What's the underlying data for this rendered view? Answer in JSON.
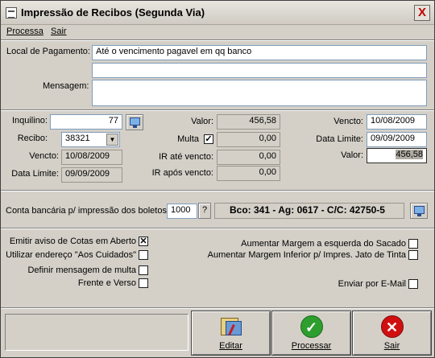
{
  "window": {
    "title": "Impressão de Recibos (Segunda Via)",
    "close": "X"
  },
  "menu": {
    "processa": "Processa",
    "sair": "Sair"
  },
  "pagamento": {
    "label": "Local de Pagamento:",
    "value": "Até o vencimento pagavel em qq banco",
    "value2": ""
  },
  "mensagem": {
    "label": "Mensagem:",
    "value": ""
  },
  "inquilino": {
    "label": "Inquilino:",
    "value": "77"
  },
  "recibo": {
    "label": "Recibo:",
    "value": "38321"
  },
  "vencto": {
    "label": "Vencto:",
    "value": "10/08/2009"
  },
  "data_limite": {
    "label": "Data Limite:",
    "value": "09/09/2009"
  },
  "valor": {
    "label": "Valor:",
    "value": "456,58"
  },
  "multa": {
    "label": "Multa",
    "checked": "✓",
    "value": "0,00"
  },
  "ir_ate": {
    "label": "IR até vencto:",
    "value": "0,00"
  },
  "ir_apos": {
    "label": "IR após vencto:",
    "value": "0,00"
  },
  "right_vencto": {
    "label": "Vencto:",
    "value": "10/08/2009"
  },
  "right_data_limite": {
    "label": "Data Limite:",
    "value": "09/09/2009"
  },
  "right_valor": {
    "label": "Valor:",
    "value": "456,58"
  },
  "conta": {
    "label": "Conta bancária p/ impressão dos boletos:",
    "value": "1000",
    "help": "?",
    "info": "Bco: 341 - Ag: 0617 - C/C: 42750-5"
  },
  "options": {
    "emitir_aviso": {
      "label": "Emitir aviso de Cotas em Aberto",
      "mark": "✕"
    },
    "endereco": {
      "label": "Utilizar endereço \"Aos Cuidados\"",
      "mark": ""
    },
    "msg_multa": {
      "label": "Definir mensagem de multa",
      "mark": ""
    },
    "frente_verso": {
      "label": "Frente e Verso",
      "mark": ""
    },
    "margem_esq": {
      "label": "Aumentar Margem a esquerda do Sacado",
      "mark": ""
    },
    "margem_inf": {
      "label": "Aumentar Margem Inferior p/ Impres. Jato de Tinta",
      "mark": ""
    },
    "email": {
      "label": "Enviar por E-Mail",
      "mark": ""
    }
  },
  "buttons": {
    "editar": "Editar",
    "processar": "Processar",
    "sair": "Sair"
  },
  "colors": {
    "ok": "#2e9e2e",
    "cancel": "#d01010",
    "input_border": "#7f9db9"
  }
}
